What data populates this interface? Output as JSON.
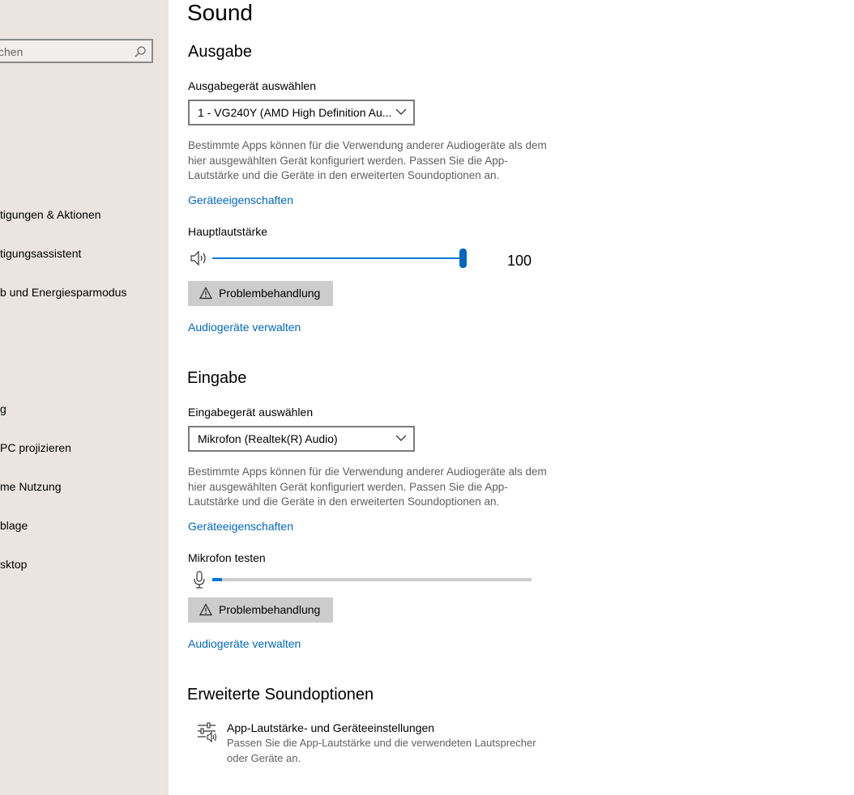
{
  "sidebar": {
    "search_placeholder": "chen",
    "items": [
      {
        "label": "tigungen & Aktionen"
      },
      {
        "label": "tigungsassistent"
      },
      {
        "label": "b und Energiesparmodus"
      },
      {
        "label": "g"
      },
      {
        "label": " PC projizieren"
      },
      {
        "label": "me Nutzung"
      },
      {
        "label": "blage"
      },
      {
        "label": "sktop"
      }
    ]
  },
  "page": {
    "title": "Sound"
  },
  "output": {
    "heading": "Ausgabe",
    "device_label": "Ausgabegerät auswählen",
    "device_value": "1 - VG240Y (AMD High Definition Au...",
    "description": "Bestimmte Apps können für die Verwendung anderer Audiogeräte als dem hier ausgewählten Gerät konfiguriert werden. Passen Sie die App-Lautstärke und die Geräte in den erweiterten Soundoptionen an.",
    "properties_link": "Geräteeigenschaften",
    "volume_label": "Hauptlautstärke",
    "volume_value": "100",
    "troubleshoot_label": "Problembehandlung",
    "manage_link": "Audiogeräte verwalten"
  },
  "input": {
    "heading": "Eingabe",
    "device_label": "Eingabegerät auswählen",
    "device_value": "Mikrofon (Realtek(R) Audio)",
    "description": "Bestimmte Apps können für die Verwendung anderer Audiogeräte als dem hier ausgewählten Gerät konfiguriert werden. Passen Sie die App-Lautstärke und die Geräte in den erweiterten Soundoptionen an.",
    "properties_link": "Geräteeigenschaften",
    "mic_test_label": "Mikrofon testen",
    "mic_level": 0.03,
    "troubleshoot_label": "Problembehandlung",
    "manage_link": "Audiogeräte verwalten"
  },
  "advanced": {
    "heading": "Erweiterte Soundoptionen",
    "item_title": "App-Lautstärke- und Geräteeinstellungen",
    "item_desc": "Passen Sie die App-Lautstärke und die verwendeten Lautsprecher oder Geräte an."
  },
  "colors": {
    "accent": "#0078d7",
    "link": "#0067c0",
    "sidebar_bg": "#ece4e1"
  },
  "icons": [
    "search-icon",
    "chevron-down-icon",
    "speaker-icon",
    "warning-icon",
    "microphone-icon",
    "sliders-speaker-icon"
  ]
}
